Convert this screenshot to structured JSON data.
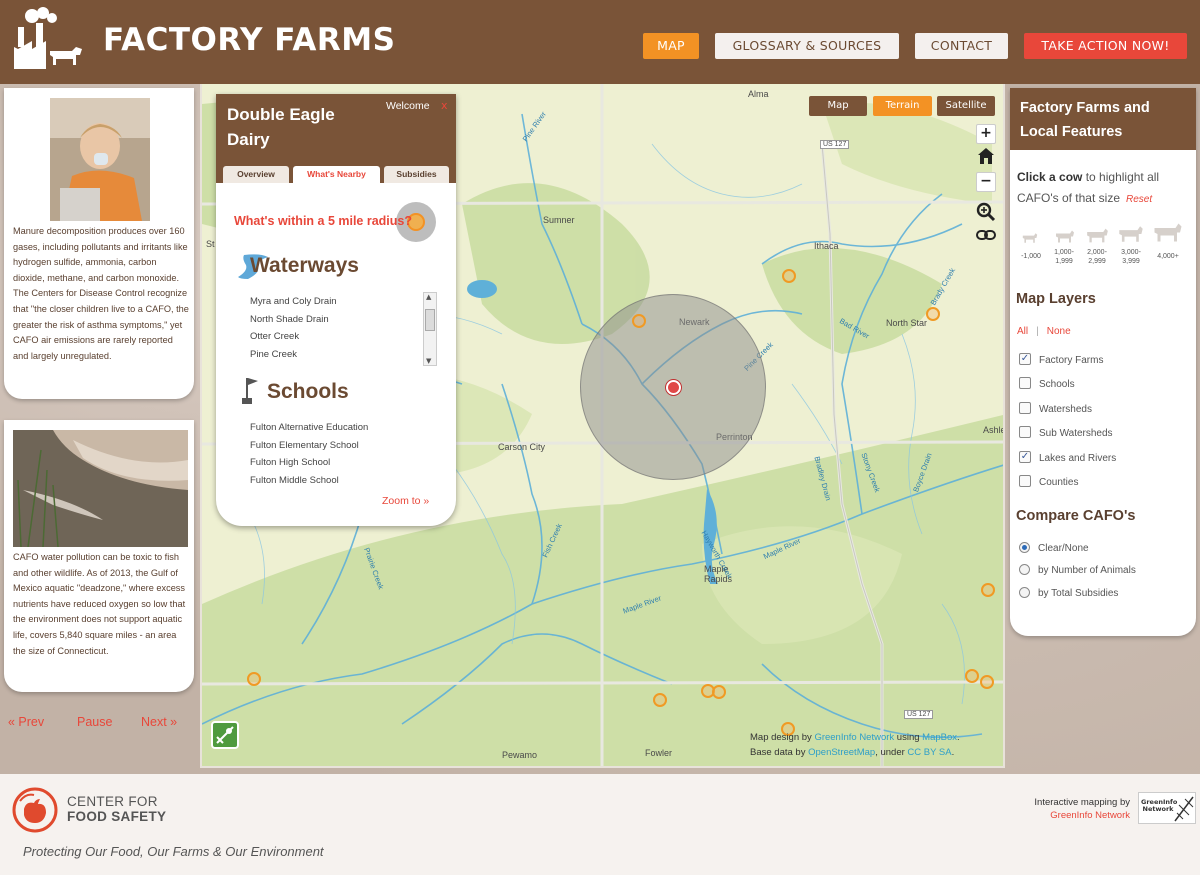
{
  "header": {
    "site_title": "FACTORY FARMS",
    "nav": {
      "map": "MAP",
      "glossary": "GLOSSARY & SOURCES",
      "contact": "CONTACT",
      "action": "TAKE ACTION NOW!"
    }
  },
  "stories": [
    {
      "text": "Manure decomposition produces over 160 gases, including pollutants and irritants like hydrogen sulfide, ammonia, carbon dioxide, methane, and carbon monoxide. The Centers for Disease Control recognize that \"the closer children live to a CAFO, the greater the risk of asthma symptoms,\" yet CAFO air emissions are rarely reported and largely unregulated."
    },
    {
      "text": "CAFO water pollution can be toxic to fish and other wildlife. As of 2013, the Gulf of Mexico aquatic \"deadzone,\" where excess nutrients have reduced oxygen so low that the environment does not support aquatic life, covers 5,840 square miles - an area the size of Connecticut."
    }
  ],
  "story_nav": {
    "prev": "« Prev",
    "pause": "Pause",
    "next": "Next »"
  },
  "map": {
    "types": {
      "map": "Map",
      "terrain": "Terrain",
      "satellite": "Satellite"
    },
    "zoom_in": "+",
    "zoom_out": "−",
    "towns": [
      "Alma",
      "Sumner",
      "Ithaca",
      "Newark",
      "North Star",
      "Carson City",
      "Perrinton",
      "Ashley",
      "Maple Rapids",
      "Pewamo",
      "Fowler",
      "St"
    ],
    "rivers": [
      "Pine River",
      "Bad River",
      "Pine Creek",
      "Maple River",
      "Fish Creek",
      "Prairie Creek",
      "Bradley Drain",
      "Boyce Drain",
      "Brady Creek",
      "Stony Creek",
      "Hayworth Creek",
      "Maple River"
    ],
    "roads": {
      "us127_n": "US 127",
      "us127_s": "US 127"
    },
    "attribution": {
      "design_prefix": "Map design by ",
      "design_org": "GreenInfo Network",
      "design_using": " using ",
      "design_tool": "MapBox",
      "design_end": ".",
      "base_prefix": "Base data by ",
      "base_org": "OpenStreetMap",
      "base_mid": ", under ",
      "base_license": "CC BY SA",
      "base_end": "."
    }
  },
  "detail": {
    "farm_name": "Double Eagle Dairy",
    "welcome": "Welcome",
    "close": "x",
    "tabs": {
      "overview": "Overview",
      "nearby": "What's Nearby",
      "subsidies": "Subsidies"
    },
    "radius_question": "What's within a 5 mile radius?",
    "waterways_title": "Waterways",
    "waterways": [
      "Myra and Coly Drain",
      "North Shade Drain",
      "Otter Creek",
      "Pine Creek"
    ],
    "schools_title": "Schools",
    "schools": [
      "Fulton Alternative Education",
      "Fulton Elementary School",
      "Fulton High School",
      "Fulton Middle School"
    ],
    "zoom_to": "Zoom to »"
  },
  "right_panel": {
    "title": "Factory Farms and Local Features",
    "click_cow_bold": "Click a cow",
    "click_cow_rest": " to highlight all CAFO's of that size",
    "reset": "Reset",
    "cow_sizes": [
      "-1,000",
      "1,000-\n1,999",
      "2,000-\n2,999",
      "3,000-\n3,999",
      "4,000+"
    ],
    "layers_title": "Map Layers",
    "all": "All",
    "none": "None",
    "layers": [
      {
        "label": "Factory Farms",
        "checked": true
      },
      {
        "label": "Schools",
        "checked": false
      },
      {
        "label": "Watersheds",
        "checked": false
      },
      {
        "label": "Sub Watersheds",
        "checked": false
      },
      {
        "label": "Lakes and Rivers",
        "checked": true
      },
      {
        "label": "Counties",
        "checked": false
      }
    ],
    "compare_title": "Compare CAFO's",
    "compare": [
      {
        "label": "Clear/None",
        "selected": true
      },
      {
        "label": "by Number of Animals",
        "selected": false
      },
      {
        "label": "by Total Subsidies",
        "selected": false
      }
    ]
  },
  "footer": {
    "org_line1": "CENTER FOR",
    "org_line2": "FOOD SAFETY",
    "tagline": "Protecting Our Food, Our Farms & Our Environment",
    "credit_line": "Interactive mapping by",
    "credit_org": "GreenInfo Network",
    "greeninfo_logo": "GreenInfo Network"
  },
  "colors": {
    "brand_brown": "#7a5438",
    "accent_orange": "#f39224",
    "action_red": "#e8473a",
    "water_blue": "#4aa3d6"
  }
}
